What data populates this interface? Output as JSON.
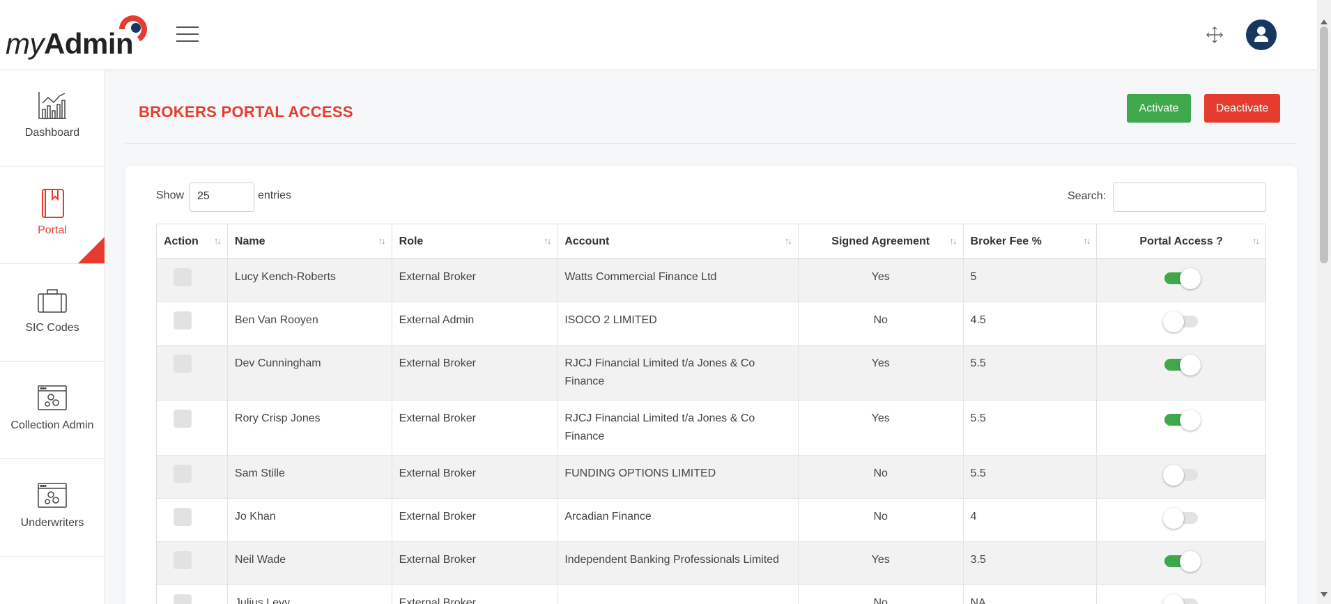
{
  "header": {
    "logo_my": "my",
    "logo_admin": "Admin"
  },
  "sidebar": {
    "items": [
      {
        "label": "Dashboard",
        "icon": "chart-icon"
      },
      {
        "label": "Portal",
        "icon": "book-icon",
        "active": true
      },
      {
        "label": "SIC Codes",
        "icon": "briefcase-icon"
      },
      {
        "label": "Collection Admin",
        "icon": "settings-window-icon"
      },
      {
        "label": "Underwriters",
        "icon": "settings-window-icon"
      }
    ]
  },
  "page": {
    "title": "BROKERS PORTAL ACCESS",
    "activate_label": "Activate",
    "deactivate_label": "Deactivate"
  },
  "table_controls": {
    "show_label": "Show",
    "entries_value": "25",
    "entries_label": "entries",
    "search_label": "Search:",
    "search_value": ""
  },
  "table": {
    "columns": [
      "Action",
      "Name",
      "Role",
      "Account",
      "Signed Agreement",
      "Broker Fee %",
      "Portal Access ?"
    ],
    "rows": [
      {
        "name": "Lucy Kench-Roberts",
        "role": "External Broker",
        "account": "Watts Commercial Finance Ltd",
        "signed": "Yes",
        "fee": "5",
        "access": true
      },
      {
        "name": "Ben Van Rooyen",
        "role": "External Admin",
        "account": "ISOCO 2 LIMITED",
        "signed": "No",
        "fee": "4.5",
        "access": false
      },
      {
        "name": "Dev Cunningham",
        "role": "External Broker",
        "account": "RJCJ Financial Limited t/a Jones & Co Finance",
        "signed": "Yes",
        "fee": "5.5",
        "access": true
      },
      {
        "name": "Rory Crisp Jones",
        "role": "External Broker",
        "account": "RJCJ Financial Limited t/a Jones & Co Finance",
        "signed": "Yes",
        "fee": "5.5",
        "access": true
      },
      {
        "name": "Sam Stille",
        "role": "External Broker",
        "account": "FUNDING OPTIONS LIMITED",
        "signed": "No",
        "fee": "5.5",
        "access": false
      },
      {
        "name": "Jo Khan",
        "role": "External Broker",
        "account": "Arcadian Finance",
        "signed": "No",
        "fee": "4",
        "access": false
      },
      {
        "name": "Neil Wade",
        "role": "External Broker",
        "account": "Independent Banking Professionals Limited",
        "signed": "Yes",
        "fee": "3.5",
        "access": true
      },
      {
        "name": "Julius Levy",
        "role": "External Broker",
        "account": "",
        "signed": "No",
        "fee": "NA",
        "access": false
      }
    ]
  },
  "colors": {
    "brand_red": "#e53c2f",
    "success_green": "#3fa84a",
    "avatar_navy": "#17375e"
  }
}
